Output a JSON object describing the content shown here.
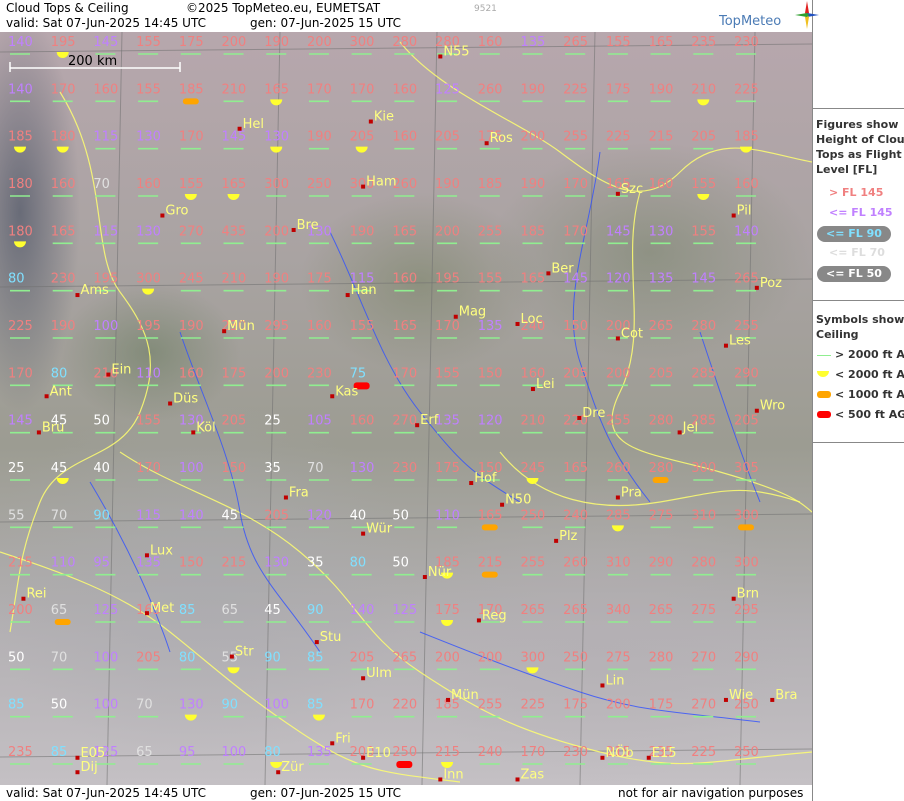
{
  "header": {
    "title": "Cloud Tops & Ceiling",
    "copyright": "©2025 TopMeteo.eu, EUMETSAT",
    "code": "9521",
    "valid": "valid:  Sat  07-Jun-2025  14:45 UTC",
    "gen": "gen: 07-Jun-2025 15 UTC",
    "brand": "TopMeteo"
  },
  "footer": {
    "valid": "valid:  Sat  07-Jun-2025  14:45 UTC",
    "gen": "gen: 07-Jun-2025 15 UTC",
    "note": "not for air navigation purposes"
  },
  "scale_label": "200 km",
  "legend": {
    "tops_title": [
      "Figures show",
      "Height of Cloud",
      "Tops as Flight",
      "Level  [FL]"
    ],
    "tops_items": [
      {
        "label": "> FL 145",
        "color": "#f08080",
        "style": "text"
      },
      {
        "label": "<= FL 145",
        "color": "#c080ff",
        "style": "text"
      },
      {
        "label": "<= FL 90",
        "color": "#80e0ff",
        "style": "pill"
      },
      {
        "label": "<= FL 70",
        "color": "#dddddd",
        "style": "text"
      },
      {
        "label": "<= FL 50",
        "color": "#ffffff",
        "style": "pill"
      }
    ],
    "ceil_title": [
      "Symbols show",
      "Ceiling"
    ],
    "ceil_items": [
      {
        "label": "> 2000 ft AGL",
        "color": "#90ee90",
        "shape": "line"
      },
      {
        "label": "< 2000 ft AGL",
        "color": "#ffff30",
        "shape": "half"
      },
      {
        "label": "< 1000 ft AGL",
        "color": "#ffa500",
        "shape": "bar"
      },
      {
        "label": "< 500 ft AGL",
        "color": "#ff0000",
        "shape": "bar"
      }
    ]
  },
  "colors": {
    "fl_hi": "#f08080",
    "fl_145": "#c080ff",
    "fl_90": "#80e0ff",
    "fl_70": "#e0e0e0",
    "fl_50": "#ffffff",
    "city": "#ffff80"
  },
  "cities": [
    {
      "name": "N55",
      "lon": 0.56,
      "lat": 0.02
    },
    {
      "name": "Kie",
      "lon": 0.47,
      "lat": 0.11
    },
    {
      "name": "Hel",
      "lon": 0.3,
      "lat": 0.12
    },
    {
      "name": "Ros",
      "lon": 0.62,
      "lat": 0.14
    },
    {
      "name": "Ham",
      "lon": 0.46,
      "lat": 0.2
    },
    {
      "name": "Szc",
      "lon": 0.79,
      "lat": 0.21
    },
    {
      "name": "Gro",
      "lon": 0.2,
      "lat": 0.24
    },
    {
      "name": "Pil",
      "lon": 0.94,
      "lat": 0.24
    },
    {
      "name": "Bre",
      "lon": 0.37,
      "lat": 0.26
    },
    {
      "name": "Ber",
      "lon": 0.7,
      "lat": 0.32
    },
    {
      "name": "Ams",
      "lon": 0.09,
      "lat": 0.35
    },
    {
      "name": "Han",
      "lon": 0.44,
      "lat": 0.35
    },
    {
      "name": "Poz",
      "lon": 0.97,
      "lat": 0.34
    },
    {
      "name": "Mag",
      "lon": 0.58,
      "lat": 0.38
    },
    {
      "name": "Lei",
      "lon": 0.68,
      "lat": 0.48
    },
    {
      "name": "Loc",
      "lon": 0.66,
      "lat": 0.39
    },
    {
      "name": "Mün",
      "lon": 0.28,
      "lat": 0.4
    },
    {
      "name": "Cot",
      "lon": 0.79,
      "lat": 0.41
    },
    {
      "name": "Les",
      "lon": 0.93,
      "lat": 0.42
    },
    {
      "name": "Ein",
      "lon": 0.13,
      "lat": 0.46
    },
    {
      "name": "Kas",
      "lon": 0.42,
      "lat": 0.49
    },
    {
      "name": "Ant",
      "lon": 0.05,
      "lat": 0.49
    },
    {
      "name": "Düs",
      "lon": 0.21,
      "lat": 0.5
    },
    {
      "name": "Wro",
      "lon": 0.97,
      "lat": 0.51
    },
    {
      "name": "Erf",
      "lon": 0.53,
      "lat": 0.53
    },
    {
      "name": "Dre",
      "lon": 0.74,
      "lat": 0.52
    },
    {
      "name": "Bru",
      "lon": 0.04,
      "lat": 0.54
    },
    {
      "name": "Köl",
      "lon": 0.24,
      "lat": 0.54
    },
    {
      "name": "Jel",
      "lon": 0.87,
      "lat": 0.54
    },
    {
      "name": "Hof",
      "lon": 0.6,
      "lat": 0.61
    },
    {
      "name": "Fra",
      "lon": 0.36,
      "lat": 0.63
    },
    {
      "name": "Pra",
      "lon": 0.79,
      "lat": 0.63
    },
    {
      "name": "N50",
      "lon": 0.64,
      "lat": 0.64
    },
    {
      "name": "Wür",
      "lon": 0.46,
      "lat": 0.68
    },
    {
      "name": "Plz",
      "lon": 0.71,
      "lat": 0.69
    },
    {
      "name": "Lux",
      "lon": 0.18,
      "lat": 0.71
    },
    {
      "name": "Nür",
      "lon": 0.54,
      "lat": 0.74
    },
    {
      "name": "Rei",
      "lon": 0.02,
      "lat": 0.77
    },
    {
      "name": "Brn",
      "lon": 0.94,
      "lat": 0.77
    },
    {
      "name": "Met",
      "lon": 0.18,
      "lat": 0.79
    },
    {
      "name": "Reg",
      "lon": 0.61,
      "lat": 0.8
    },
    {
      "name": "Stu",
      "lon": 0.4,
      "lat": 0.83
    },
    {
      "name": "Str",
      "lon": 0.29,
      "lat": 0.85
    },
    {
      "name": "Ulm",
      "lon": 0.46,
      "lat": 0.88
    },
    {
      "name": "Lin",
      "lon": 0.77,
      "lat": 0.89
    },
    {
      "name": "Mün",
      "lon": 0.57,
      "lat": 0.91
    },
    {
      "name": "Wie",
      "lon": 0.93,
      "lat": 0.91
    },
    {
      "name": "Bra",
      "lon": 0.99,
      "lat": 0.91
    },
    {
      "name": "Fri",
      "lon": 0.42,
      "lat": 0.97
    },
    {
      "name": "E05",
      "lon": 0.09,
      "lat": 0.99
    },
    {
      "name": "E10",
      "lon": 0.46,
      "lat": 0.99
    },
    {
      "name": "NÖb",
      "lon": 0.77,
      "lat": 0.99
    },
    {
      "name": "E15",
      "lon": 0.83,
      "lat": 0.99
    },
    {
      "name": "Dij",
      "lon": 0.09,
      "lat": 1.01
    },
    {
      "name": "Zür",
      "lon": 0.35,
      "lat": 1.01
    },
    {
      "name": "Inn",
      "lon": 0.56,
      "lat": 1.02
    },
    {
      "name": "Zas",
      "lon": 0.66,
      "lat": 1.02
    }
  ],
  "fl_rows": [
    [
      "140",
      "195",
      "145",
      "155",
      "175",
      "200",
      "190",
      "200",
      "300",
      "280",
      "280",
      "160",
      "135",
      "265",
      "155",
      "165",
      "235",
      "230"
    ],
    [
      "140",
      "170",
      "160",
      "155",
      "185",
      "210",
      "165",
      "170",
      "170",
      "160",
      "125",
      "260",
      "190",
      "225",
      "175",
      "190",
      "210",
      "225"
    ],
    [
      "185",
      "180",
      "115",
      "130",
      "170",
      "145",
      "130",
      "190",
      "205",
      "160",
      "205",
      "175",
      "200",
      "255",
      "225",
      "215",
      "205",
      "185"
    ],
    [
      "180",
      "160",
      "70",
      "160",
      "155",
      "165",
      "300",
      "250",
      "300",
      "260",
      "190",
      "185",
      "190",
      "170",
      "165",
      "160",
      "155",
      "160"
    ],
    [
      "180",
      "165",
      "115",
      "130",
      "270",
      "435",
      "200",
      "130",
      "190",
      "165",
      "200",
      "255",
      "185",
      "170",
      "145",
      "130",
      "155",
      "140"
    ],
    [
      "80",
      "230",
      "195",
      "300",
      "245",
      "210",
      "190",
      "175",
      "115",
      "160",
      "195",
      "155",
      "165",
      "145",
      "120",
      "135",
      "145",
      "265"
    ],
    [
      "225",
      "190",
      "100",
      "195",
      "190",
      "230",
      "295",
      "160",
      "155",
      "165",
      "170",
      "135",
      "240",
      "150",
      "200",
      "265",
      "280",
      "255"
    ],
    [
      "170",
      "80",
      "210",
      "110",
      "160",
      "175",
      "200",
      "230",
      "75",
      "170",
      "155",
      "150",
      "160",
      "205",
      "200",
      "205",
      "285",
      "290"
    ],
    [
      "145",
      "45",
      "50",
      "155",
      "130",
      "205",
      "25",
      "105",
      "160",
      "270",
      "135",
      "120",
      "210",
      "220",
      "255",
      "280",
      "285",
      "205"
    ],
    [
      "25",
      "45",
      "40",
      "170",
      "100",
      "150",
      "35",
      "70",
      "130",
      "230",
      "175",
      "150",
      "245",
      "165",
      "260",
      "280",
      "300",
      "305"
    ],
    [
      "55",
      "70",
      "90",
      "115",
      "140",
      "45",
      "205",
      "120",
      "40",
      "50",
      "110",
      "165",
      "250",
      "240",
      "285",
      "275",
      "310",
      "300"
    ],
    [
      "215",
      "110",
      "95",
      "135",
      "150",
      "215",
      "130",
      "35",
      "80",
      "50",
      "185",
      "215",
      "255",
      "260",
      "310",
      "290",
      "280",
      "300"
    ],
    [
      "200",
      "65",
      "125",
      "165",
      "85",
      "65",
      "45",
      "90",
      "140",
      "125",
      "175",
      "170",
      "265",
      "265",
      "340",
      "265",
      "275",
      "295"
    ],
    [
      "50",
      "70",
      "100",
      "205",
      "80",
      "55",
      "90",
      "85",
      "205",
      "265",
      "200",
      "200",
      "300",
      "250",
      "275",
      "280",
      "270",
      "290"
    ],
    [
      "85",
      "50",
      "100",
      "70",
      "130",
      "90",
      "100",
      "85",
      "170",
      "220",
      "185",
      "255",
      "225",
      "175",
      "200",
      "175",
      "270",
      "250"
    ],
    [
      "235",
      "85",
      "125",
      "65",
      "95",
      "100",
      "80",
      "135",
      "200",
      "250",
      "215",
      "240",
      "170",
      "230",
      "215",
      "235",
      "225",
      "250"
    ]
  ],
  "sym_rows": [
    [
      "line",
      "half",
      "line",
      "line",
      "line",
      "line",
      "line",
      "line",
      "line",
      "line",
      "line",
      "line",
      "line",
      "line",
      "line",
      "line",
      "line",
      "line"
    ],
    [
      "line",
      "line",
      "line",
      "line",
      "bar",
      "line",
      "half",
      "line",
      "line",
      "line",
      "line",
      "line",
      "line",
      "line",
      "line",
      "line",
      "half",
      "line"
    ],
    [
      "half",
      "half",
      "line",
      "line",
      "line",
      "line",
      "half",
      "line",
      "half",
      "line",
      "line",
      "line",
      "line",
      "line",
      "line",
      "line",
      "line",
      "half"
    ],
    [
      "line",
      "line",
      "line",
      "line",
      "half",
      "half",
      "line",
      "line",
      "line",
      "line",
      "line",
      "line",
      "line",
      "line",
      "line",
      "line",
      "half",
      "line"
    ],
    [
      "half",
      "line",
      "line",
      "line",
      "line",
      "line",
      "line",
      "line",
      "line",
      "line",
      "line",
      "line",
      "line",
      "line",
      "line",
      "line",
      "line",
      "line"
    ],
    [
      "line",
      "line",
      "line",
      "half",
      "line",
      "line",
      "line",
      "line",
      "line",
      "line",
      "line",
      "line",
      "line",
      "line",
      "line",
      "line",
      "line",
      "line"
    ],
    [
      "line",
      "line",
      "line",
      "line",
      "line",
      "line",
      "line",
      "line",
      "line",
      "line",
      "line",
      "line",
      "line",
      "line",
      "line",
      "line",
      "line",
      "line"
    ],
    [
      "line",
      "line",
      "line",
      "line",
      "line",
      "line",
      "line",
      "line",
      "red",
      "line",
      "line",
      "line",
      "line",
      "line",
      "line",
      "line",
      "line",
      "line"
    ],
    [
      "line",
      "line",
      "line",
      "line",
      "line",
      "line",
      "line",
      "line",
      "line",
      "line",
      "line",
      "line",
      "line",
      "line",
      "line",
      "line",
      "line",
      "line"
    ],
    [
      "line",
      "half",
      "line",
      "line",
      "line",
      "line",
      "line",
      "line",
      "line",
      "line",
      "line",
      "line",
      "half",
      "line",
      "line",
      "bar",
      "line",
      "line"
    ],
    [
      "line",
      "line",
      "line",
      "line",
      "line",
      "line",
      "line",
      "line",
      "line",
      "line",
      "line",
      "bar",
      "line",
      "line",
      "half",
      "line",
      "line",
      "bar"
    ],
    [
      "line",
      "line",
      "line",
      "line",
      "line",
      "line",
      "line",
      "line",
      "line",
      "line",
      "half",
      "bar",
      "line",
      "line",
      "line",
      "line",
      "line",
      "line"
    ],
    [
      "line",
      "bar",
      "line",
      "line",
      "line",
      "line",
      "line",
      "line",
      "line",
      "line",
      "half",
      "line",
      "line",
      "line",
      "line",
      "line",
      "line",
      "line"
    ],
    [
      "line",
      "line",
      "line",
      "line",
      "line",
      "half",
      "line",
      "line",
      "line",
      "line",
      "line",
      "line",
      "half",
      "line",
      "line",
      "line",
      "line",
      "line"
    ],
    [
      "line",
      "line",
      "line",
      "line",
      "half",
      "line",
      "line",
      "half",
      "line",
      "line",
      "line",
      "line",
      "line",
      "line",
      "line",
      "line",
      "line",
      "line"
    ],
    [
      "line",
      "line",
      "line",
      "line",
      "line",
      "line",
      "half",
      "line",
      "line",
      "red",
      "half",
      "line",
      "line",
      "line",
      "line",
      "line",
      "line",
      "line"
    ]
  ]
}
